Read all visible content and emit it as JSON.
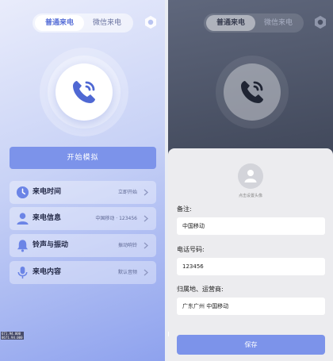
{
  "left": {
    "tabs": [
      {
        "label": "普通来电",
        "active": true
      },
      {
        "label": "微信来电",
        "active": false
      }
    ],
    "icons": {
      "settings": "gear-icon",
      "phone": "phone-ringing-icon"
    },
    "start_button": "开始模拟",
    "menu": [
      {
        "label": "来电时间",
        "value": "立即开始",
        "icon": "clock-icon"
      },
      {
        "label": "来电信息",
        "value": "中国移动 · 123456",
        "icon": "person-icon"
      },
      {
        "label": "铃声与振动",
        "value": "振动响铃",
        "icon": "bell-icon"
      },
      {
        "label": "来电内容",
        "value": "默认音频",
        "icon": "microphone-icon"
      }
    ],
    "stamp": [
      "671.94.000",
      "8671.94.000"
    ]
  },
  "right": {
    "tabs": [
      {
        "label": "普通来电",
        "active": true
      },
      {
        "label": "微信来电",
        "active": false
      }
    ],
    "sheet": {
      "avatar_hint": "点击设置头像",
      "fields": [
        {
          "label": "备注:",
          "value": "中国移动"
        },
        {
          "label": "电话号码:",
          "value": "123456"
        },
        {
          "label": "归属地、运营商:",
          "value": "广东广州 中国移动"
        }
      ],
      "save_button": "保存"
    }
  },
  "colors": {
    "accent": "#7c93ea",
    "icon_blue": "#5b72d8"
  }
}
